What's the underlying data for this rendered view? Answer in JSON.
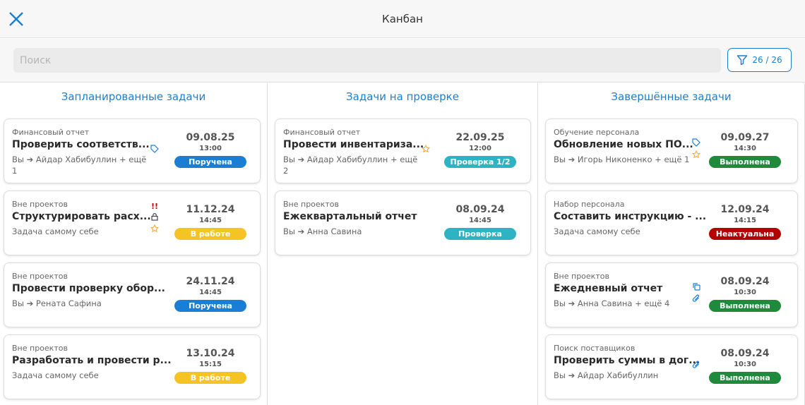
{
  "header": {
    "title": "Канбан",
    "close_icon": "close-icon"
  },
  "search": {
    "placeholder": "Поиск",
    "value": ""
  },
  "filter": {
    "label": "26 / 26",
    "icon": "filter-icon"
  },
  "colors": {
    "accent": "#1a7fd4",
    "assigned": "#1a7fd4",
    "in_work": "#f5c324",
    "review": "#2eb3c4",
    "done": "#1f8a3c",
    "irrelevant": "#b30000"
  },
  "columns": [
    {
      "title": "Запланированные задачи",
      "cards": [
        {
          "project": "Финансовый отчет",
          "name": "Проверить соответств...",
          "who": "Вы ➔ Айдар Хабибуллин + ещё 1",
          "date": "09.08.25",
          "time": "13:00",
          "status": "Поручена",
          "status_color": "#1a7fd4",
          "icons": [
            "tag"
          ]
        },
        {
          "project": "Вне проектов",
          "name": "Структурировать расх...",
          "who": "Задача самому себе",
          "date": "11.12.24",
          "time": "14:45",
          "status": "В работе",
          "status_color": "#f5c324",
          "icons": [
            "priority",
            "lock",
            "star"
          ]
        },
        {
          "project": "Вне проектов",
          "name": "Провести проверку обор...",
          "who": "Вы ➔ Рената Сафина",
          "date": "24.11.24",
          "time": "14:45",
          "status": "Поручена",
          "status_color": "#1a7fd4",
          "icons": []
        },
        {
          "project": "Вне проектов",
          "name": "Разработать и провести р...",
          "who": "Задача самому себе",
          "date": "13.10.24",
          "time": "15:15",
          "status": "В работе",
          "status_color": "#f5c324",
          "icons": []
        }
      ]
    },
    {
      "title": "Задачи на проверке",
      "cards": [
        {
          "project": "Финансовый отчет",
          "name": "Провести инвентариза...",
          "who": "Вы ➔ Айдар Хабибуллин + ещё 2",
          "date": "22.09.25",
          "time": "12:00",
          "status": "Проверка 1/2",
          "status_color": "#2eb3c4",
          "icons": [
            "star"
          ]
        },
        {
          "project": "Вне проектов",
          "name": "Ежеквартальный отчет",
          "who": "Вы ➔ Анна Савина",
          "date": "08.09.24",
          "time": "14:45",
          "status": "Проверка",
          "status_color": "#2eb3c4",
          "icons": []
        }
      ]
    },
    {
      "title": "Завершённые задачи",
      "cards": [
        {
          "project": "Обучение персонала",
          "name": "Обновление новых ПО...",
          "who": "Вы ➔ Игорь Никоненко + ещё 1",
          "date": "09.09.27",
          "time": "14:30",
          "status": "Выполнена",
          "status_color": "#1f8a3c",
          "icons": [
            "tag",
            "star"
          ]
        },
        {
          "project": "Набор персонала",
          "name": "Составить инструкцию - ...",
          "who": "Задача самому себе",
          "date": "12.09.24",
          "time": "14:15",
          "status": "Неактуальна",
          "status_color": "#b30000",
          "icons": []
        },
        {
          "project": "Вне проектов",
          "name": "Ежедневный отчет",
          "who": "Вы ➔ Анна Савина + ещё 4",
          "date": "08.09.24",
          "time": "10:30",
          "status": "Выполнена",
          "status_color": "#1f8a3c",
          "icons": [
            "copy",
            "paperclip"
          ]
        },
        {
          "project": "Поиск поставщиков",
          "name": "Проверить суммы в дог...",
          "who": "Вы ➔ Айдар Хабибуллин",
          "date": "08.09.24",
          "time": "10:30",
          "status": "Выполнена",
          "status_color": "#1f8a3c",
          "icons": [
            "paperclip"
          ]
        }
      ]
    }
  ]
}
